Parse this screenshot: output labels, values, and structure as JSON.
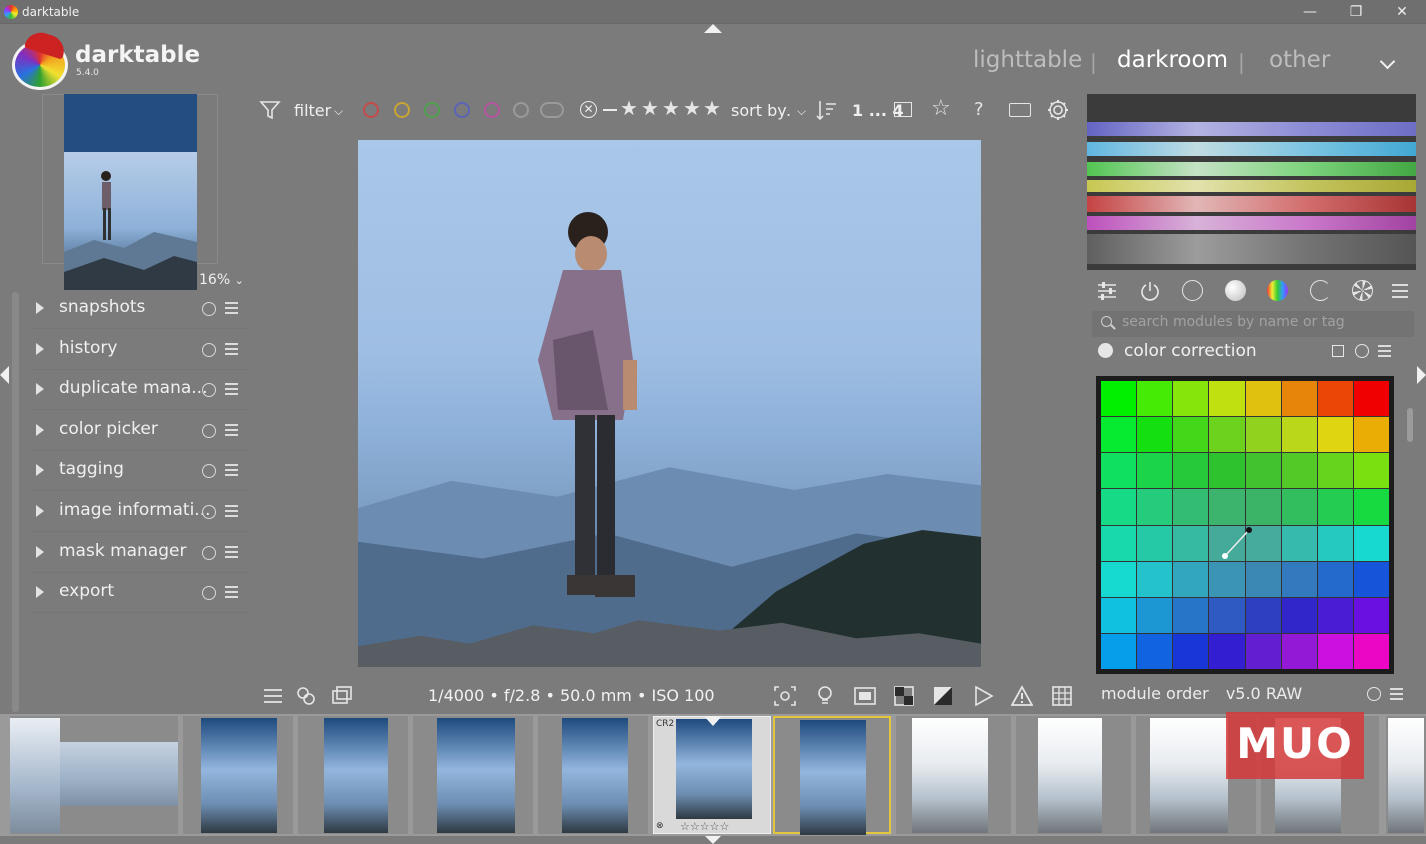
{
  "window": {
    "title": "darktable"
  },
  "header": {
    "app_name": "darktable",
    "version": "5.4.0",
    "views": [
      "lighttable",
      "darkroom",
      "other"
    ],
    "active_view": "darkroom"
  },
  "navigation": {
    "zoom": "16%"
  },
  "left_modules": [
    {
      "label": "snapshots"
    },
    {
      "label": "history"
    },
    {
      "label": "duplicate mana..."
    },
    {
      "label": "color picker"
    },
    {
      "label": "tagging"
    },
    {
      "label": "image informati..."
    },
    {
      "label": "mask manager"
    },
    {
      "label": "export"
    }
  ],
  "top_toolbar": {
    "filter_label": "filter",
    "sort_label": "sort by",
    "sort_value": ".",
    "count_label": "1 ... 4",
    "color_labels": [
      "#c54b4b",
      "#c9a534",
      "#4fa14f",
      "#5b64b8",
      "#b653a0"
    ],
    "rating_stars": 5
  },
  "image_info": {
    "exif": "1/4000 • f/2.8 • 50.0 mm • ISO 100"
  },
  "right_panel": {
    "search_placeholder": "search modules by name or tag",
    "module_title": "color correction",
    "module_order_label": "module order",
    "module_order_value": "v5.0 RAW"
  },
  "filmstrip": {
    "active_badge": "CR2",
    "watermark": "MUO"
  },
  "colors": {
    "panel_bg": "#7b7b7b",
    "accent_active": "#ffffff",
    "inactive_tab": "#bdbdbd",
    "selected_thumb_border": "#e3c640"
  }
}
